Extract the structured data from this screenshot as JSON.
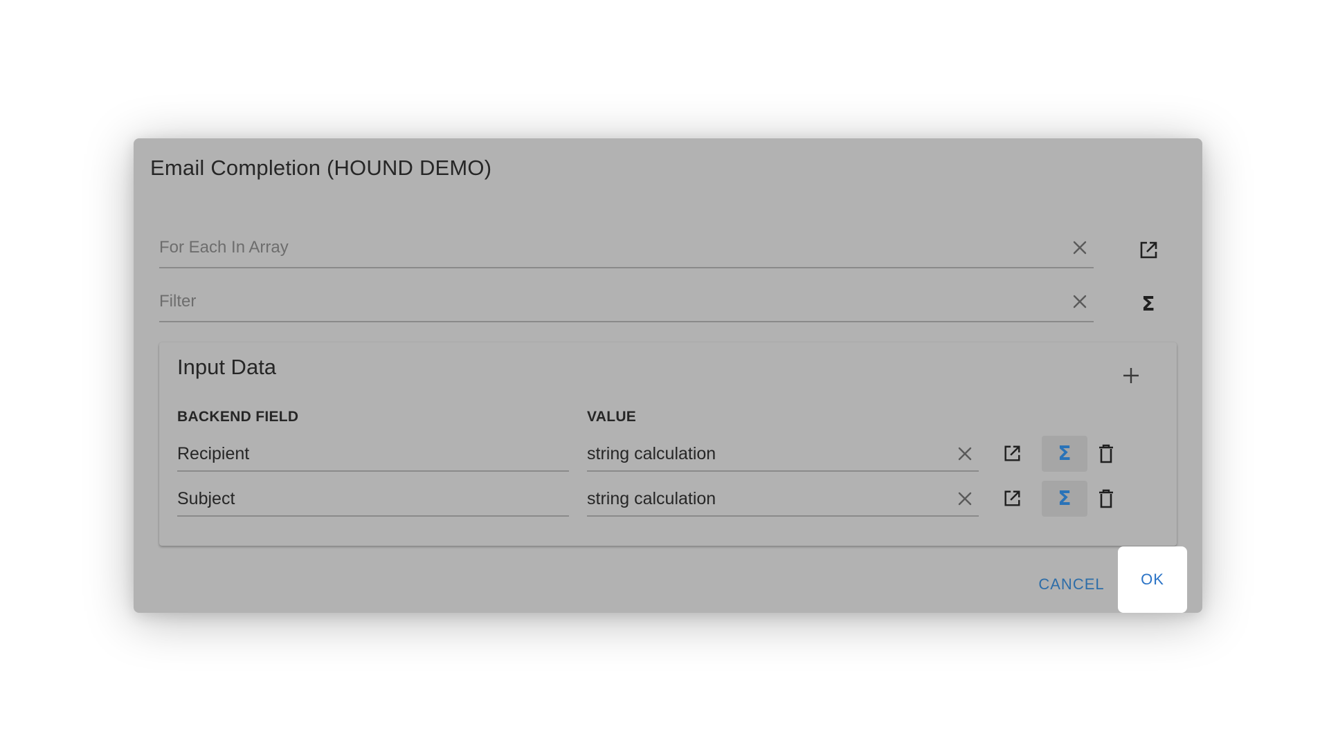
{
  "dialog": {
    "title": "Email Completion (HOUND DEMO)"
  },
  "for_each_field": {
    "placeholder": "For Each In Array",
    "clear_icon": "close-icon",
    "side_icon": "open-in-new-icon"
  },
  "filter_field": {
    "placeholder": "Filter",
    "clear_icon": "close-icon",
    "side_icon": "sigma-icon"
  },
  "input_data": {
    "title": "Input Data",
    "add_icon": "plus-icon",
    "columns": {
      "backend_field": "BACKEND FIELD",
      "value": "VALUE"
    },
    "rows": [
      {
        "backend_field": "Recipient",
        "value": "string calculation"
      },
      {
        "backend_field": "Subject",
        "value": "string calculation"
      }
    ]
  },
  "footer": {
    "cancel_label": "CANCEL",
    "ok_label": "OK"
  },
  "colors": {
    "accent": "#2a73b8",
    "overlay_gray": "#b2b2b2",
    "ok_background": "#ffffff"
  }
}
